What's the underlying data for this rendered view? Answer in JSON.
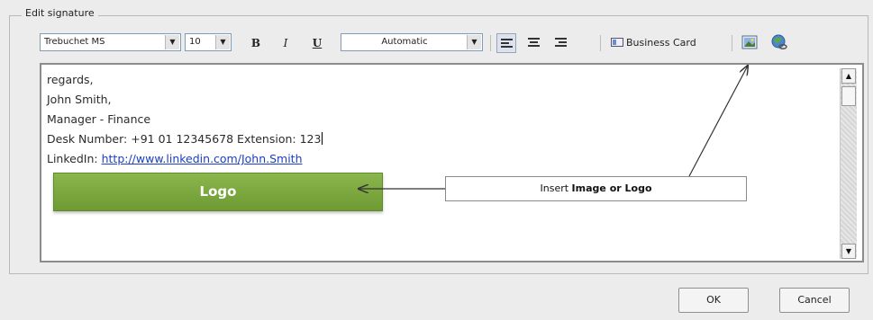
{
  "group": {
    "legend": "Edit signature"
  },
  "toolbar": {
    "font_family": "Trebuchet MS",
    "font_size": "10",
    "bold_label": "B",
    "italic_label": "I",
    "underline_label": "U",
    "color": "Automatic",
    "business_card_label": "Business Card"
  },
  "editor": {
    "lines": [
      "regards,",
      "John Smith,",
      "Manager - Finance",
      "Desk Number: +91 01 12345678 Extension: 123"
    ],
    "linkedin_label": "LinkedIn:",
    "linkedin_url": "http://www.linkedin.com/John.Smith"
  },
  "logo": {
    "label": "Logo"
  },
  "callout": {
    "prefix": "Insert ",
    "bold": "Image or Logo"
  },
  "buttons": {
    "ok": "OK",
    "cancel": "Cancel"
  }
}
